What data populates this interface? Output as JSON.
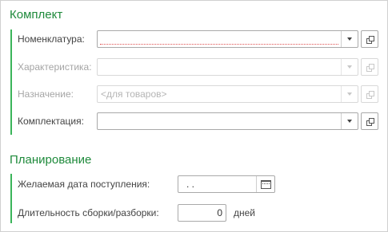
{
  "section_kit": {
    "title": "Комплект",
    "nomenclature": {
      "label": "Номенклатура:",
      "value": ""
    },
    "characteristic": {
      "label": "Характеристика:",
      "value": ""
    },
    "purpose": {
      "label": "Назначение:",
      "value": "<для товаров>"
    },
    "kit": {
      "label": "Комплектация:",
      "value": ""
    }
  },
  "section_planning": {
    "title": "Планирование",
    "receipt_date": {
      "label": "Желаемая дата поступления:",
      "value": " .  ."
    },
    "duration": {
      "label": "Длительность сборки/разборки:",
      "value": "0",
      "unit": "дней"
    }
  },
  "icons": [
    "dropdown-arrow-icon",
    "open-form-icon",
    "calendar-icon"
  ],
  "colors": {
    "section_title": "#1e8a3b",
    "group_bar": "#3bb55a",
    "required_underline": "#e05050"
  }
}
